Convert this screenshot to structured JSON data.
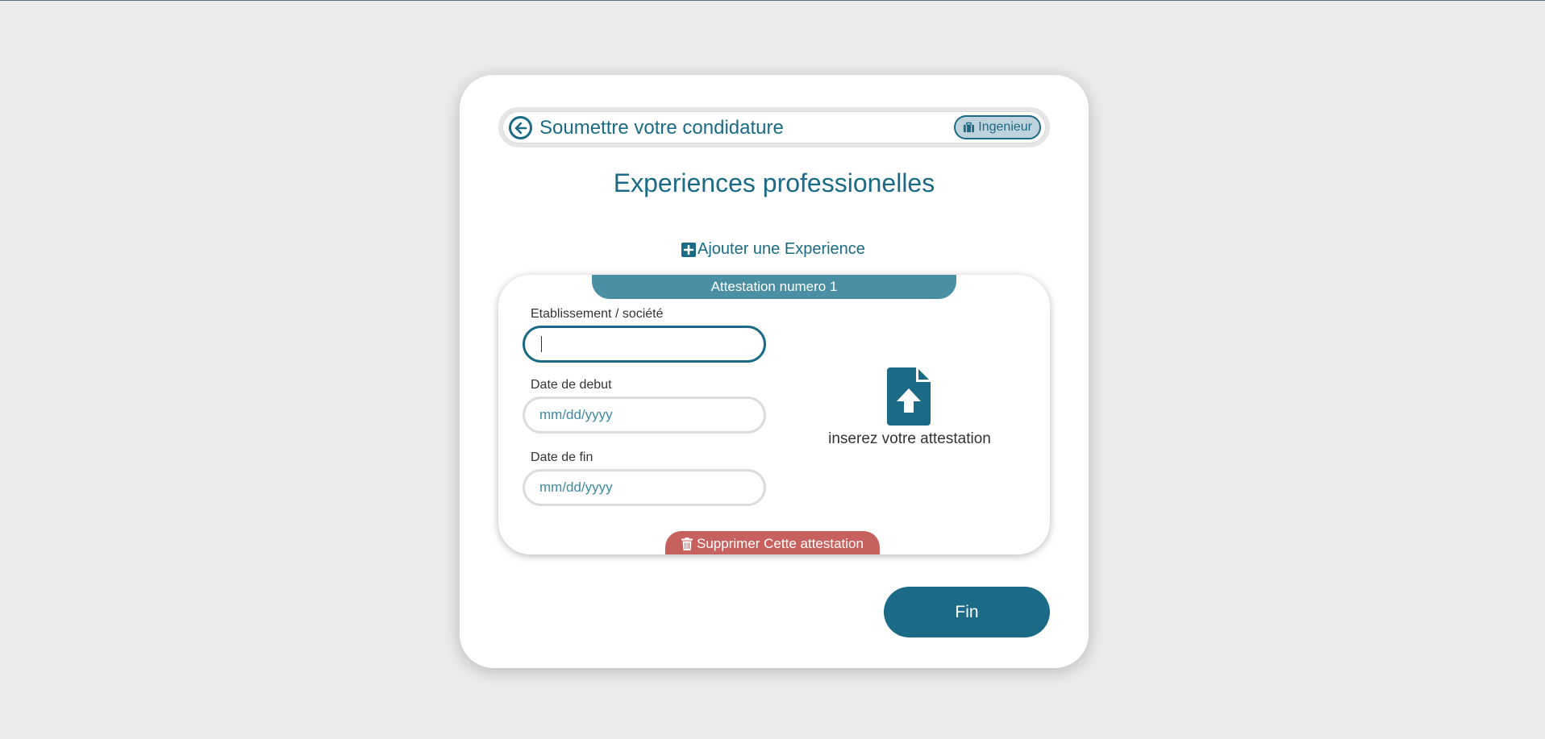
{
  "header": {
    "title": "Soumettre votre condidature",
    "role_badge": "Ingenieur"
  },
  "section_title": "Experiences professionelles",
  "add_experience_label": "Ajouter une Experience",
  "experience": {
    "tab_label": "Attestation numero 1",
    "establishment_label": "Etablissement / société",
    "establishment_value": "",
    "start_date_label": "Date de debut",
    "start_date_placeholder": "mm/dd/yyyy",
    "end_date_label": "Date de fin",
    "end_date_placeholder": "mm/dd/yyyy",
    "upload_label": "inserez votre attestation",
    "delete_label": "Supprimer Cette attestation"
  },
  "finish_label": "Fin",
  "colors": {
    "primary": "#1b6b86",
    "tab": "#4a8fa3",
    "danger": "#c7615d",
    "background": "#ececec"
  },
  "icons": {
    "back": "arrow-left-circle-icon",
    "role": "briefcase-icon",
    "add": "plus-square-icon",
    "upload": "file-upload-icon",
    "delete": "trash-icon"
  }
}
